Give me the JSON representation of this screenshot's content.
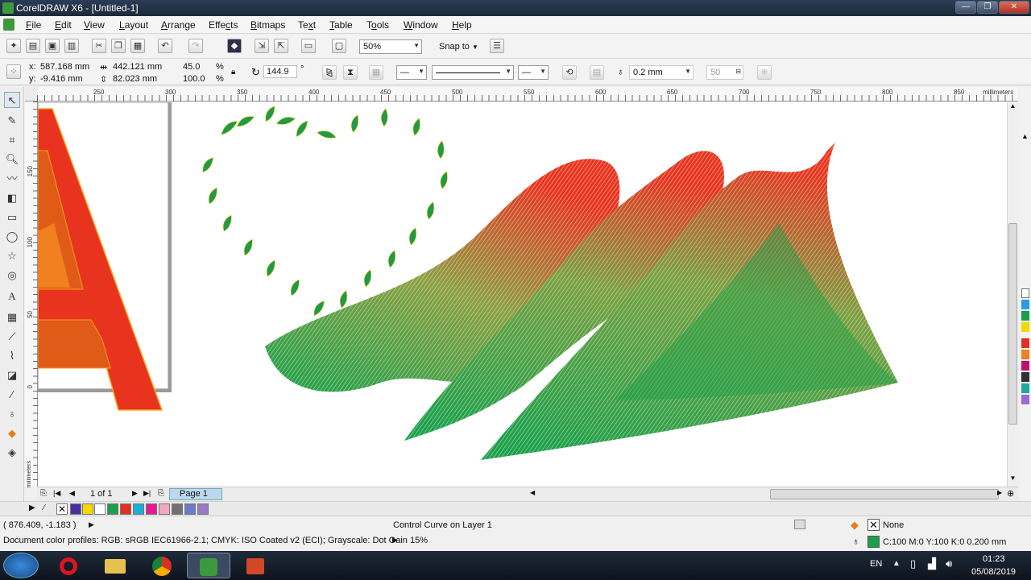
{
  "window": {
    "title": "CorelDRAW X6 - [Untitled-1]",
    "min": "—",
    "max": "❐",
    "close": "✕"
  },
  "menu": [
    "File",
    "Edit",
    "View",
    "Layout",
    "Arrange",
    "Effects",
    "Bitmaps",
    "Text",
    "Table",
    "Tools",
    "Window",
    "Help"
  ],
  "menu_accel": [
    "F",
    "E",
    "V",
    "L",
    "A",
    "c",
    "B",
    "x",
    "T",
    "o",
    "W",
    "H"
  ],
  "toolbar": {
    "zoom": "50%",
    "snap_to": "Snap to"
  },
  "properties": {
    "x_label": "x:",
    "x": "587.168 mm",
    "y_label": "y:",
    "y": "-9.416 mm",
    "width": "442.121 mm",
    "height": "82.023 mm",
    "scale_w": "45.0",
    "scale_h": "100.0",
    "pct": "%",
    "rotation": "144.9",
    "deg": "°",
    "outline_width": "0.2 mm",
    "value_50": "50"
  },
  "ruler": {
    "top_ticks": [
      "250",
      "300",
      "350",
      "400",
      "450",
      "500",
      "550",
      "600",
      "650",
      "700",
      "750",
      "800",
      "850"
    ],
    "unit": "millimeters",
    "left_ticks": [
      "150",
      "100",
      "50",
      "0"
    ],
    "left_unit": "millimeters"
  },
  "page_nav": {
    "count": "1 of 1",
    "tab": "Page 1"
  },
  "palette": [
    "#4a2fa0",
    "#2a2aa0",
    "#f5d800",
    "#ffffff",
    "#1aa04a",
    "#e03020",
    "#18b0d8",
    "#e81890",
    "#f4a8c0",
    "#707070",
    "#6a7ad0",
    "#9a78c8"
  ],
  "palette_right": [
    "#ffffff",
    "#9a6bd0",
    "#2a9ee0",
    "#1aa04a",
    "#f5d800",
    "#e03020",
    "#f08020",
    "#c01070",
    "#303030",
    "#20a8a0"
  ],
  "status": {
    "coords": "( 876.409, -1.183 )",
    "message": "Control Curve on Layer 1",
    "profiles": "Document color profiles: RGB: sRGB IEC61966-2.1; CMYK: ISO Coated v2 (ECI); Grayscale: Dot Gain 15%",
    "fill": "None",
    "outline": "C:100 M:0 Y:100 K:0  0.200 mm"
  },
  "taskbar": {
    "lang": "EN",
    "time": "01:23",
    "date": "05/08/2019"
  },
  "colors": {
    "green": "#1aa04a",
    "red": "#e8341e",
    "leaf": "#1f9a48"
  }
}
